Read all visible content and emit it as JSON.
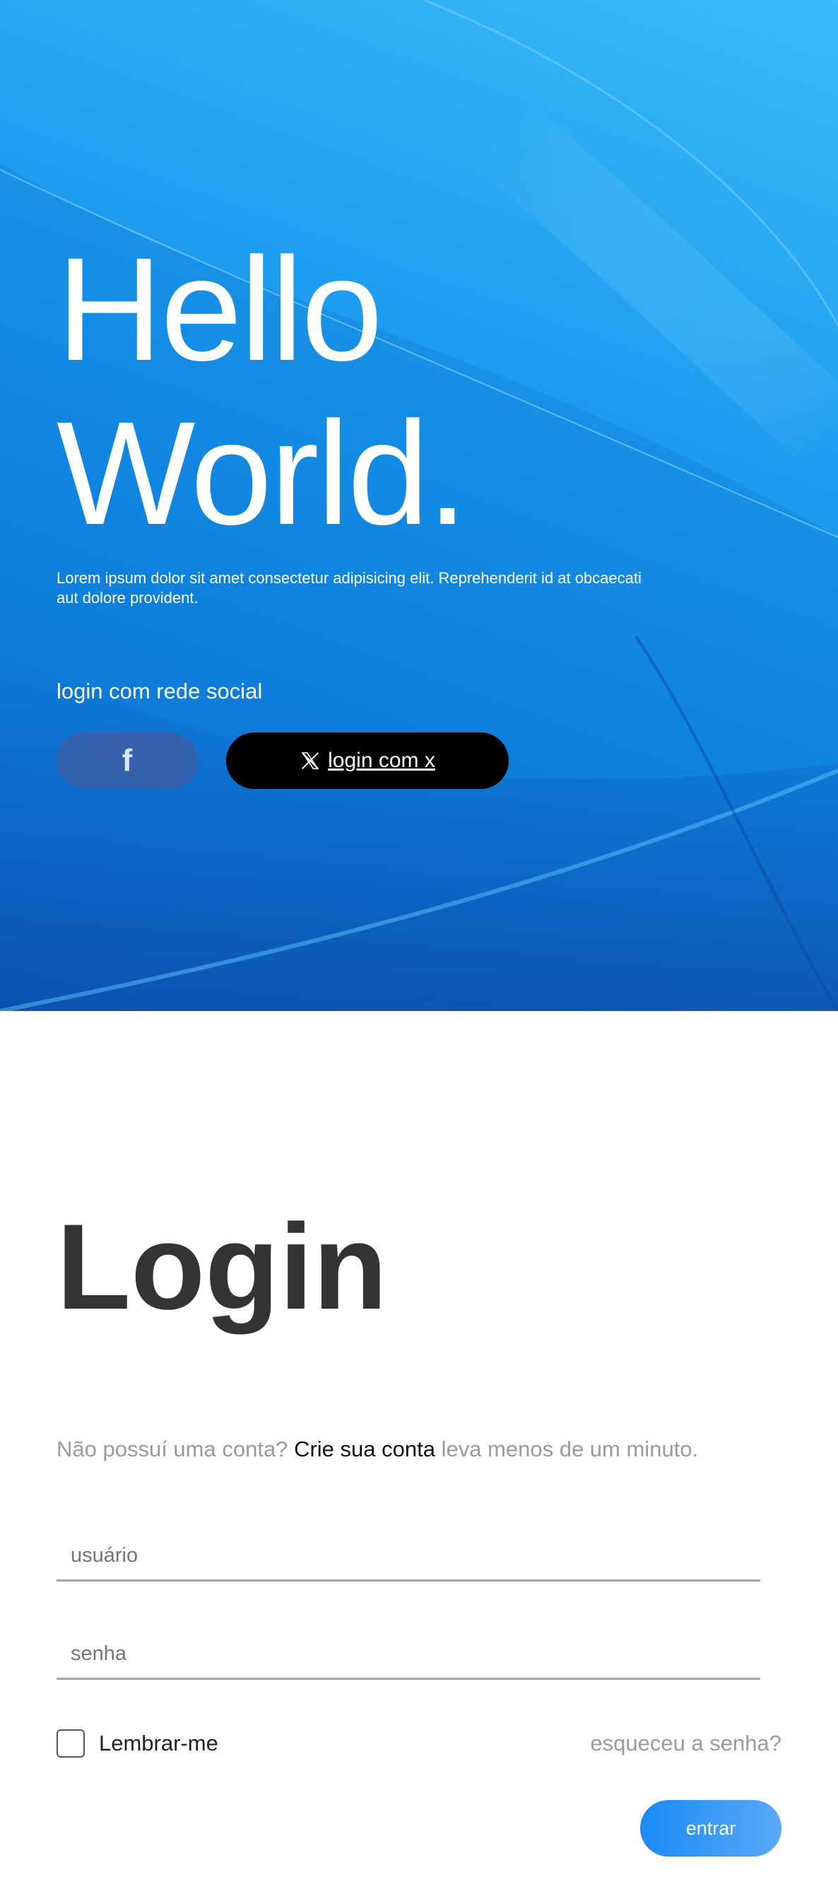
{
  "hero": {
    "title_line1": "Hello",
    "title_line2": "World.",
    "description": "Lorem ipsum dolor sit amet consectetur adipisicing elit. Reprehenderit id at obcaecati aut dolore provident.",
    "social_label": "login com rede social",
    "facebook_icon": "f",
    "x_button_label": "login com x"
  },
  "login": {
    "title": "Login",
    "signup_prefix": "Não possuí uma conta?",
    "signup_link": "Crie sua conta",
    "signup_suffix": "leva menos de um minuto.",
    "username_placeholder": "usuário",
    "password_placeholder": "senha",
    "remember_label": "Lembrar-me",
    "forgot_label": "esqueceu a senha?",
    "submit_label": "entrar"
  },
  "colors": {
    "hero_blue": "#1e9ef0",
    "facebook": "#3c5fa8",
    "x_button": "#000000",
    "title_dark": "#333333",
    "muted_text": "#9a9a9a",
    "submit_gradient_start": "#1a8af6",
    "submit_gradient_end": "#5aaaf8"
  },
  "icons": {
    "facebook": "facebook-icon",
    "x": "x-logo-icon"
  }
}
